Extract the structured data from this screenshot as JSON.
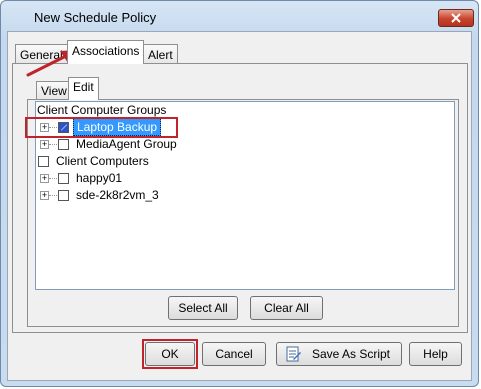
{
  "window": {
    "title": "New Schedule Policy"
  },
  "tabs": [
    {
      "label": "General"
    },
    {
      "label": "Associations"
    },
    {
      "label": "Alert"
    }
  ],
  "subtabs": [
    {
      "label": "View"
    },
    {
      "label": "Edit"
    }
  ],
  "tree": {
    "header_groups": "Client Computer Groups",
    "items_groups": [
      {
        "label": "Laptop Backup"
      },
      {
        "label": "MediaAgent Group"
      }
    ],
    "header_computers": "Client Computers",
    "items_computers": [
      {
        "label": "happy01"
      },
      {
        "label": "sde-2k8r2vm_3"
      }
    ]
  },
  "panel_buttons": {
    "select_all": "Select All",
    "clear_all": "Clear All"
  },
  "footer_buttons": {
    "ok": "OK",
    "cancel": "Cancel",
    "save_as_script": "Save As Script",
    "help": "Help"
  },
  "colors": {
    "highlight": "#c0232b",
    "selection": "#3399ff",
    "close_button": "#c8442c"
  },
  "icons": {
    "close": "close-icon",
    "script": "script-icon",
    "arrow": "annotation-arrow-icon"
  }
}
